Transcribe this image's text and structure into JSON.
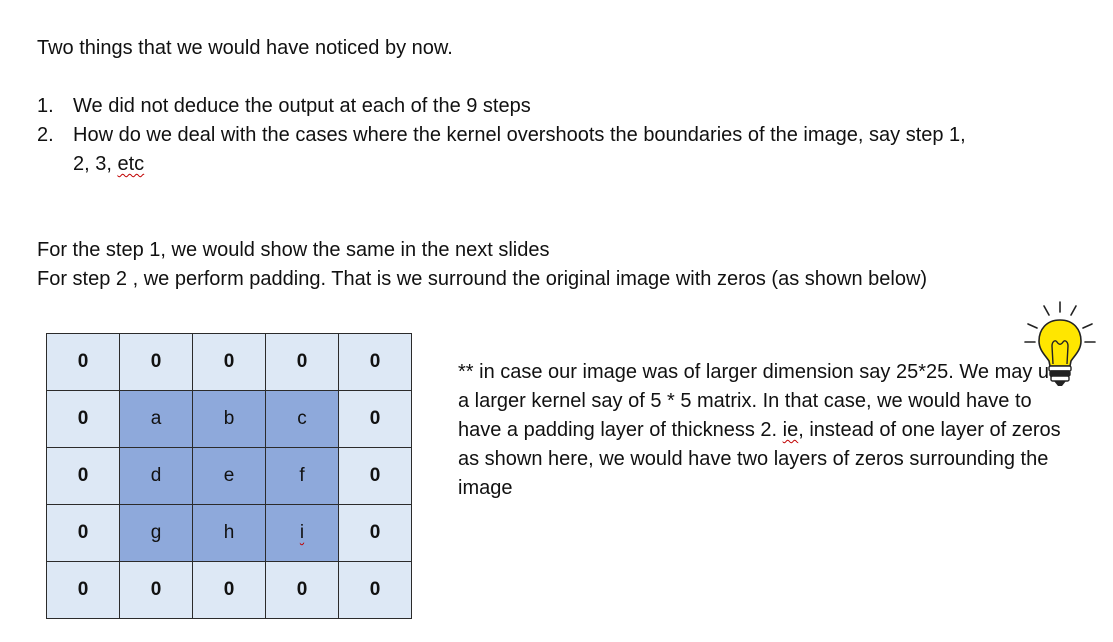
{
  "intro": "Two things that we would have noticed by now.",
  "list": [
    {
      "num": "1.",
      "text": "We did not deduce the output at each of the 9 steps"
    },
    {
      "num": "2.",
      "text": "How do we deal with the cases where the kernel overshoots the boundaries of the image, say step 1,",
      "continuation": "2, 3,",
      "squiggle": "etc"
    }
  ],
  "step1_line": "For the step 1, we would show the same in the next slides",
  "step2_line": "For step 2 , we perform padding. That is we surround the original image with zeros (as shown below)",
  "grid": [
    [
      "0",
      "0",
      "0",
      "0",
      "0"
    ],
    [
      "0",
      "a",
      "b",
      "c",
      "0"
    ],
    [
      "0",
      "d",
      "e",
      "f",
      "0"
    ],
    [
      "0",
      "g",
      "h",
      "i",
      "0"
    ],
    [
      "0",
      "0",
      "0",
      "0",
      "0"
    ]
  ],
  "note": {
    "part1": "** in case our image was of larger dimension say 25*25. We may use a larger kernel say of 5 * 5 matrix. In that case, we would have to have a padding layer of thickness 2.",
    "squiggle": "ie",
    "part2": ", instead of one layer of zeros as shown here, we would have two layers of zeros surrounding the image"
  },
  "colors": {
    "padding_cell": "#dde8f5",
    "image_cell": "#8ea9db",
    "bulb": "#ffe600"
  },
  "icons": {
    "idea": "lightbulb-icon"
  }
}
